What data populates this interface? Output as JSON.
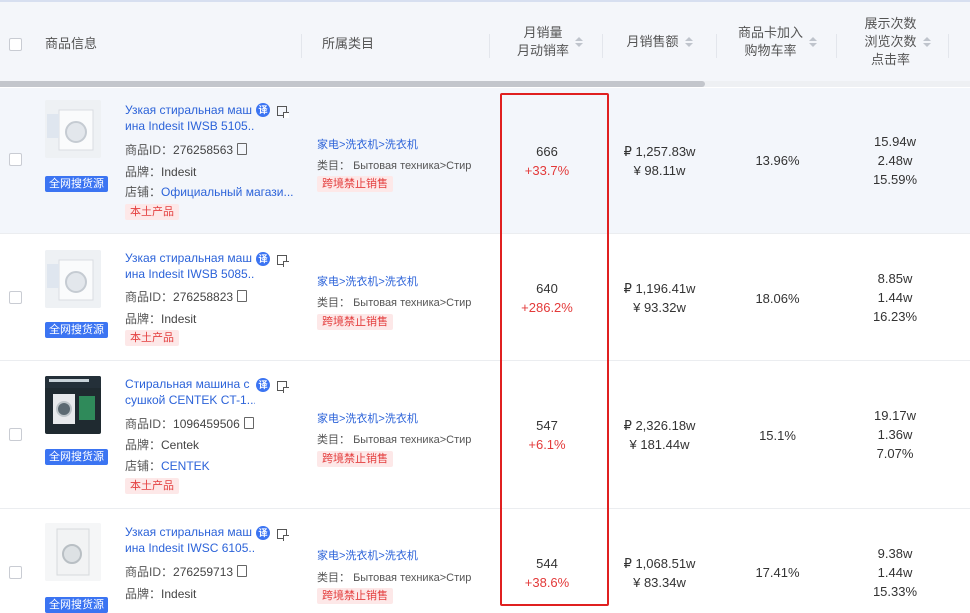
{
  "header": {
    "product_info": "商品信息",
    "category": "所属类目",
    "monthly_sales": [
      "月销量",
      "月动销率"
    ],
    "monthly_revenue": "月销售额",
    "cart_rate": [
      "商品卡加入",
      "购物车率"
    ],
    "views": [
      "展示次数",
      "浏览次数",
      "点击率"
    ]
  },
  "labels": {
    "id": "商品ID：",
    "brand": "品牌：",
    "shop": "店铺：",
    "search_all": "全网搜货源",
    "local": "本土产品",
    "translate": "译",
    "cat_prefix": "类目：",
    "banned": "跨境禁止销售"
  },
  "rows": [
    {
      "title1": "Узкая стиральная маш",
      "title2": "ина Indesit IWSB 5105...",
      "id": "276258563",
      "brand": "Indesit",
      "shop": "Официальный магази...",
      "local": true,
      "cat_path": "家电>洗衣机>洗衣机",
      "cat_name": "Бытовая техника>Стир",
      "sales": "666",
      "sales_rate": "+33.7%",
      "rev_rub": "₽ 1,257.83w",
      "rev_cny": "¥ 98.11w",
      "cart": "13.96%",
      "v1": "15.94w",
      "v2": "2.48w",
      "v3": "15.59%"
    },
    {
      "title1": "Узкая стиральная маш",
      "title2": "ина Indesit IWSB 5085...",
      "id": "276258823",
      "brand": "Indesit",
      "shop": "",
      "local": true,
      "cat_path": "家电>洗衣机>洗衣机",
      "cat_name": "Бытовая техника>Стир",
      "sales": "640",
      "sales_rate": "+286.2%",
      "rev_rub": "₽ 1,196.41w",
      "rev_cny": "¥ 93.32w",
      "cart": "18.06%",
      "v1": "8.85w",
      "v2": "1.44w",
      "v3": "16.23%"
    },
    {
      "title1": "Стиральная машина с",
      "title2": "сушкой CENTEK CT-1...",
      "id": "1096459506",
      "brand": "Centek",
      "shop": "CENTEK",
      "local": true,
      "cat_path": "家电>洗衣机>洗衣机",
      "cat_name": "Бытовая техника>Стир",
      "sales": "547",
      "sales_rate": "+6.1%",
      "rev_rub": "₽ 2,326.18w",
      "rev_cny": "¥ 181.44w",
      "cart": "15.1%",
      "v1": "19.17w",
      "v2": "1.36w",
      "v3": "7.07%"
    },
    {
      "title1": "Узкая стиральная маш",
      "title2": "ина Indesit IWSC 6105...",
      "id": "276259713",
      "brand": "Indesit",
      "shop": "",
      "local": true,
      "cat_path": "家电>洗衣机>洗衣机",
      "cat_name": "Бытовая техника>Стир",
      "sales": "544",
      "sales_rate": "+38.6%",
      "rev_rub": "₽ 1,068.51w",
      "rev_cny": "¥ 83.34w",
      "cart": "17.41%",
      "v1": "9.38w",
      "v2": "1.44w",
      "v3": "15.33%"
    }
  ]
}
